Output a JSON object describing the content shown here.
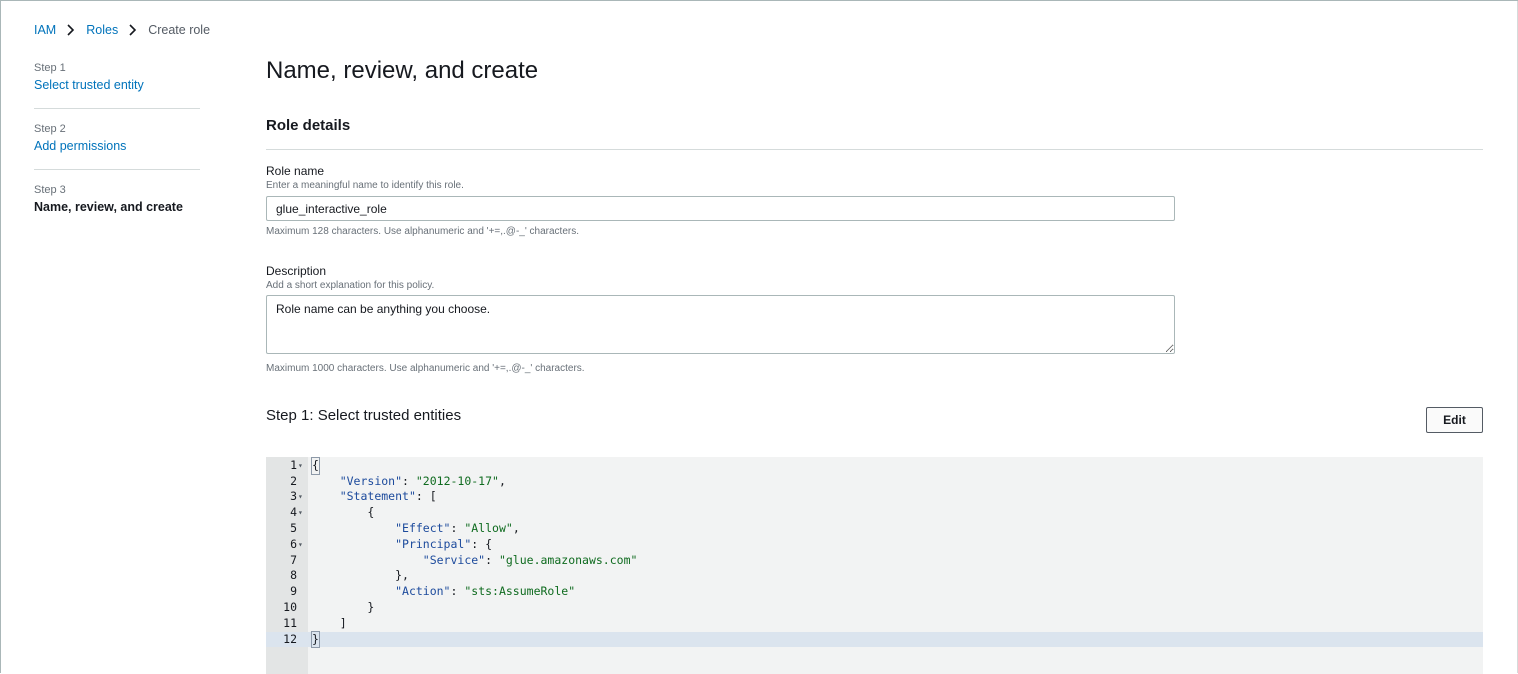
{
  "breadcrumb": {
    "items": [
      "IAM",
      "Roles"
    ],
    "current": "Create role"
  },
  "steps": [
    {
      "num": "Step 1",
      "label": "Select trusted entity"
    },
    {
      "num": "Step 2",
      "label": "Add permissions"
    },
    {
      "num": "Step 3",
      "label": "Name, review, and create"
    }
  ],
  "page": {
    "title": "Name, review, and create"
  },
  "role_details": {
    "title": "Role details",
    "role_name": {
      "label": "Role name",
      "description": "Enter a meaningful name to identify this role.",
      "value": "glue_interactive_role",
      "hint": "Maximum 128 characters. Use alphanumeric and '+=,.@-_' characters."
    },
    "description": {
      "label": "Description",
      "description": "Add a short explanation for this policy.",
      "value": "Role name can be anything you choose.",
      "hint": "Maximum 1000 characters. Use alphanumeric and '+=,.@-_' characters."
    }
  },
  "trusted_entities": {
    "title": "Step 1: Select trusted entities",
    "edit_label": "Edit",
    "code_lines": [
      {
        "n": "1",
        "fold": true,
        "text": "{"
      },
      {
        "n": "2",
        "fold": false,
        "text": "    \"Version\": \"2012-10-17\","
      },
      {
        "n": "3",
        "fold": true,
        "text": "    \"Statement\": ["
      },
      {
        "n": "4",
        "fold": true,
        "text": "        {"
      },
      {
        "n": "5",
        "fold": false,
        "text": "            \"Effect\": \"Allow\","
      },
      {
        "n": "6",
        "fold": true,
        "text": "            \"Principal\": {"
      },
      {
        "n": "7",
        "fold": false,
        "text": "                \"Service\": \"glue.amazonaws.com\""
      },
      {
        "n": "8",
        "fold": false,
        "text": "            },"
      },
      {
        "n": "9",
        "fold": false,
        "text": "            \"Action\": \"sts:AssumeRole\""
      },
      {
        "n": "10",
        "fold": false,
        "text": "        }"
      },
      {
        "n": "11",
        "fold": false,
        "text": "    ]"
      },
      {
        "n": "12",
        "fold": false,
        "text": "}"
      }
    ],
    "active_line": "12"
  },
  "icons": {
    "breadcrumb_separator": "chevron-right-icon",
    "fold_marker": "fold-caret-icon"
  }
}
